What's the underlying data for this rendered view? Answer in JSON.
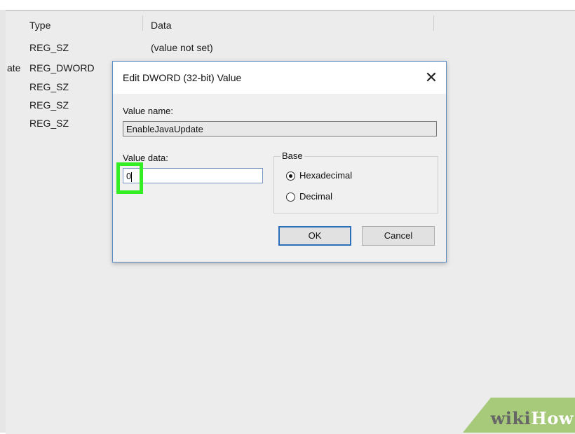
{
  "columns": {
    "type_header": "Type",
    "data_header": "Data"
  },
  "rows": [
    {
      "name_fragment": "",
      "type": "REG_SZ",
      "data": "(value not set)"
    },
    {
      "name_fragment": "ate",
      "type": "REG_DWORD",
      "data": ""
    },
    {
      "name_fragment": "",
      "type": "REG_SZ",
      "data": ""
    },
    {
      "name_fragment": "",
      "type": "REG_SZ",
      "data": ""
    },
    {
      "name_fragment": "",
      "type": "REG_SZ",
      "data": ""
    }
  ],
  "dialog": {
    "title": "Edit DWORD (32-bit) Value",
    "close_glyph": "✕",
    "value_name_label": "Value name:",
    "value_name": "EnableJavaUpdate",
    "value_data_label": "Value data:",
    "value_data": "0",
    "base_label": "Base",
    "base_options": [
      {
        "label": "Hexadecimal",
        "selected": true
      },
      {
        "label": "Decimal",
        "selected": false
      }
    ],
    "ok_label": "OK",
    "cancel_label": "Cancel"
  },
  "watermark": {
    "wiki": "wiki",
    "how": "How"
  },
  "colors": {
    "highlight": "#33ee22",
    "dialog_border": "#5b8bc4",
    "watermark_green": "#a6c97a"
  }
}
